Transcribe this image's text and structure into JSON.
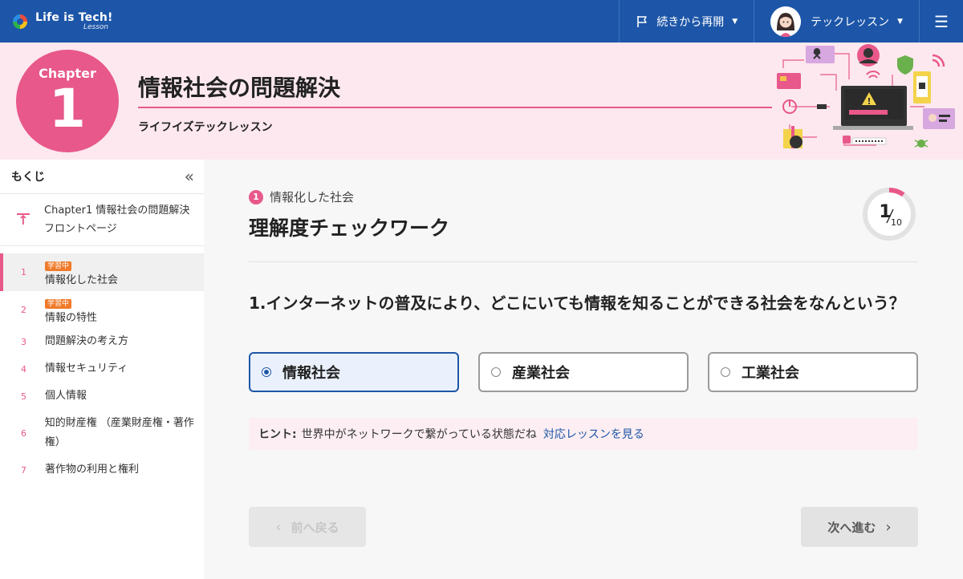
{
  "header": {
    "logo_main": "Life is Tech!",
    "logo_sub": "Lesson",
    "resume_label": "続きから再開",
    "user_name": "テックレッスン"
  },
  "chapter": {
    "badge_label": "Chapter",
    "badge_number": "1",
    "title": "情報社会の問題解決",
    "subtitle": "ライフイズテックレッスン"
  },
  "sidebar": {
    "title": "もくじ",
    "front_page": {
      "line1": "Chapter1 情報社会の問題解決",
      "line2": "フロントページ"
    },
    "items": [
      {
        "num": "1",
        "label": "情報化した社会",
        "badge": "学習中"
      },
      {
        "num": "2",
        "label": "情報の特性",
        "badge": "学習中"
      },
      {
        "num": "3",
        "label": "問題解決の考え方"
      },
      {
        "num": "4",
        "label": "情報セキュリティ"
      },
      {
        "num": "5",
        "label": "個人情報"
      },
      {
        "num": "6",
        "label": "知的財産権 （産業財産権・著作権）"
      },
      {
        "num": "7",
        "label": "著作物の利用と権利"
      }
    ]
  },
  "main": {
    "section_number": "1",
    "section_label": "情報化した社会",
    "page_title": "理解度チェックワーク",
    "progress": {
      "current": "1",
      "total": "10",
      "fraction": 0.1
    },
    "question": {
      "number": "1.",
      "text": "インターネットの普及により、どこにいても情報を知ることができる社会をなんという？"
    },
    "options": [
      {
        "label": "情報社会",
        "selected": true
      },
      {
        "label": "産業社会",
        "selected": false
      },
      {
        "label": "工業社会",
        "selected": false
      }
    ],
    "hint": {
      "label": "ヒント:",
      "text": "世界中がネットワークで繋がっている状態だね",
      "link": "対応レッスンを見る"
    },
    "prev_label": "前へ戻る",
    "next_label": "次へ進む"
  },
  "colors": {
    "brand_blue": "#1d56a8",
    "accent_pink": "#e8588a",
    "status_orange": "#f07a29"
  },
  "icons": [
    "flag-icon",
    "chevron-down-icon",
    "menu-icon",
    "collapse-icon",
    "back-to-top-icon",
    "chevron-left-icon",
    "chevron-right-icon"
  ]
}
